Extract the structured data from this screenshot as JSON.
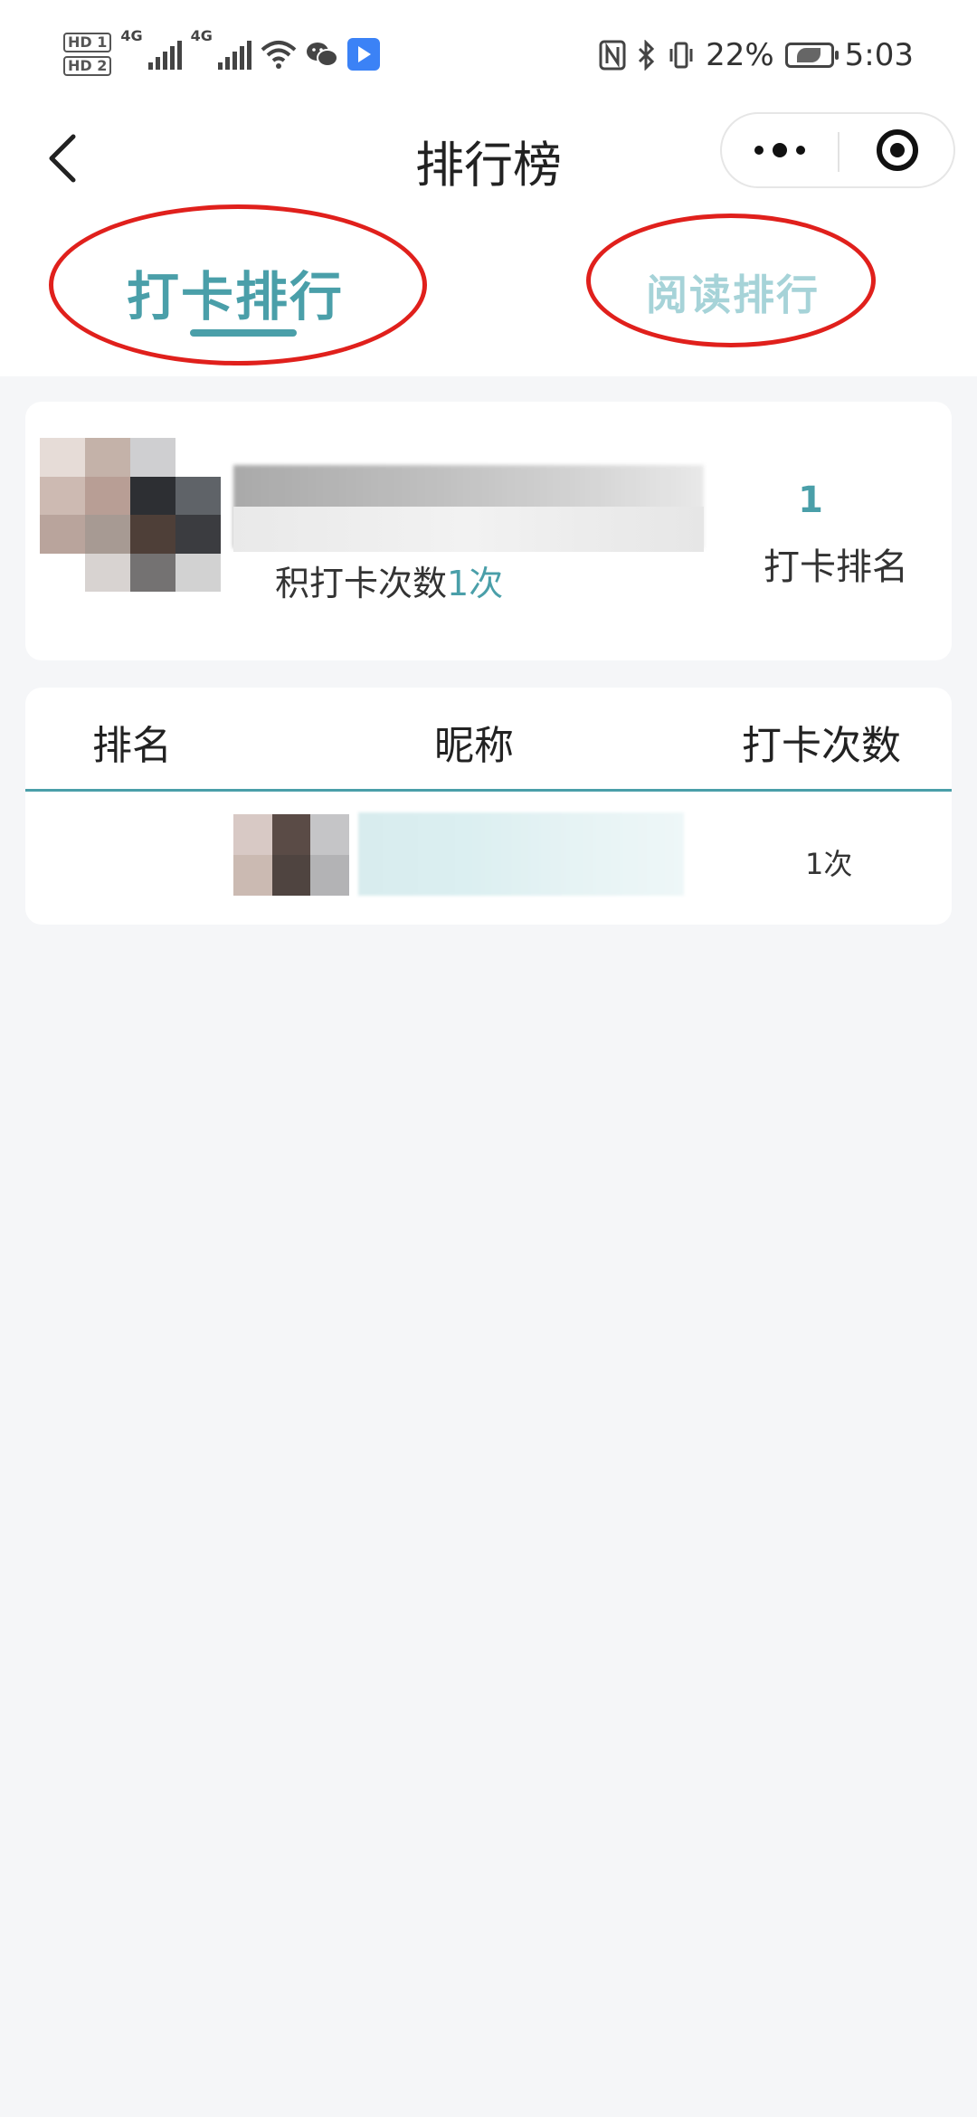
{
  "status_bar": {
    "hd1": "HD 1",
    "hd2": "HD 2",
    "signal1_label": "4G",
    "signal2_label": "4G",
    "battery_percent": "22%",
    "time": "5:03"
  },
  "nav": {
    "title": "排行榜"
  },
  "tabs": [
    {
      "label": "打卡排行",
      "active": true
    },
    {
      "label": "阅读排行",
      "active": false
    }
  ],
  "my_card": {
    "count_prefix": "积打卡次数",
    "count_value": "1次",
    "rank_value": "1",
    "rank_label": "打卡排名"
  },
  "table": {
    "headers": [
      "排名",
      "昵称",
      "打卡次数"
    ],
    "rows": [
      {
        "rank": "",
        "count": "1次"
      }
    ]
  },
  "colors": {
    "accent": "#4a9fa9",
    "annotation": "#e0201c",
    "background": "#f5f6f8"
  }
}
